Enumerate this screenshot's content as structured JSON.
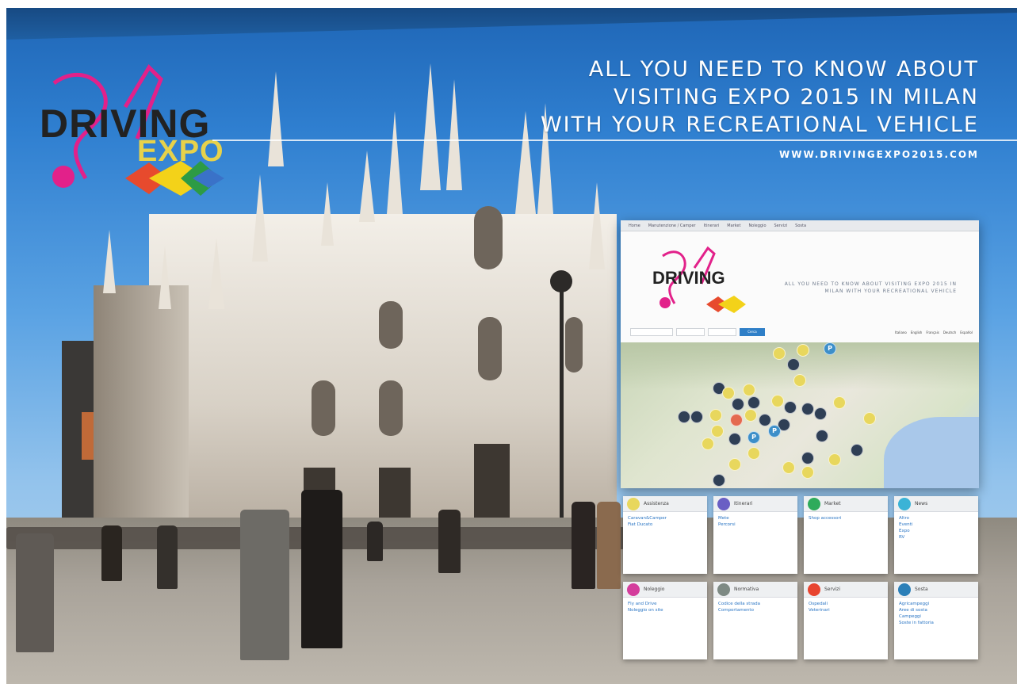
{
  "headline": {
    "line1": "ALL YOU NEED TO KNOW ABOUT",
    "line2": "VISITING EXPO 2015 IN MILAN",
    "line3": "WITH YOUR RECREATIONAL VEHICLE",
    "url": "WWW.DRIVINGEXPO2015.COM"
  },
  "logo": {
    "main": "DRIVING",
    "sub": "EXPO"
  },
  "site": {
    "nav": [
      "Home",
      "Manutenzione / Camper",
      "Itinerari",
      "Market",
      "Noleggio",
      "Servizi",
      "Sosta"
    ],
    "logo_main": "DRIVING",
    "logo_sub": "EXPO",
    "tagline": "ALL YOU NEED TO KNOW ABOUT VISITING EXPO 2015 IN MILAN WITH YOUR RECREATIONAL VEHICLE",
    "search_button": "Cerca",
    "languages": [
      "Italiano",
      "English",
      "Français",
      "Deutsch",
      "Español"
    ]
  },
  "tiles": [
    {
      "title": "Assistenza",
      "count": "",
      "color": "#e8d75d",
      "items": [
        {
          "label": "Caravan&Camper",
          "count": ""
        },
        {
          "label": "Fiat Ducato",
          "count": ""
        }
      ]
    },
    {
      "title": "Itinerari",
      "count": "",
      "color": "#6a5fc4",
      "items": [
        {
          "label": "Mete",
          "count": ""
        },
        {
          "label": "Percorsi",
          "count": ""
        }
      ]
    },
    {
      "title": "Market",
      "count": "",
      "color": "#2fab5b",
      "items": [
        {
          "label": "Shop accessori",
          "count": ""
        }
      ]
    },
    {
      "title": "News",
      "count": "",
      "color": "#3bb3d6",
      "items": [
        {
          "label": "Altro",
          "count": ""
        },
        {
          "label": "Eventi",
          "count": ""
        },
        {
          "label": "Expo",
          "count": ""
        },
        {
          "label": "RV",
          "count": ""
        }
      ]
    },
    {
      "title": "Noleggio",
      "count": "",
      "color": "#d43d9c",
      "items": [
        {
          "label": "Fly and Drive",
          "count": ""
        },
        {
          "label": "Noleggio on site",
          "count": ""
        }
      ]
    },
    {
      "title": "Normativa",
      "count": "",
      "color": "#7e8a84",
      "items": [
        {
          "label": "Codice della strada",
          "count": ""
        },
        {
          "label": "Comportamento",
          "count": ""
        }
      ]
    },
    {
      "title": "Servizi",
      "count": "",
      "color": "#e8442f",
      "items": [
        {
          "label": "Ospedali",
          "count": ""
        },
        {
          "label": "Veterinari",
          "count": ""
        }
      ]
    },
    {
      "title": "Sosta",
      "count": "",
      "color": "#2b7fb8",
      "items": [
        {
          "label": "Agricampeggi",
          "count": ""
        },
        {
          "label": "Aree di sosta",
          "count": ""
        },
        {
          "label": "Campeggi",
          "count": ""
        },
        {
          "label": "Soste in fattoria",
          "count": ""
        }
      ]
    }
  ],
  "map_pin_labels": {
    "parking": "P"
  }
}
